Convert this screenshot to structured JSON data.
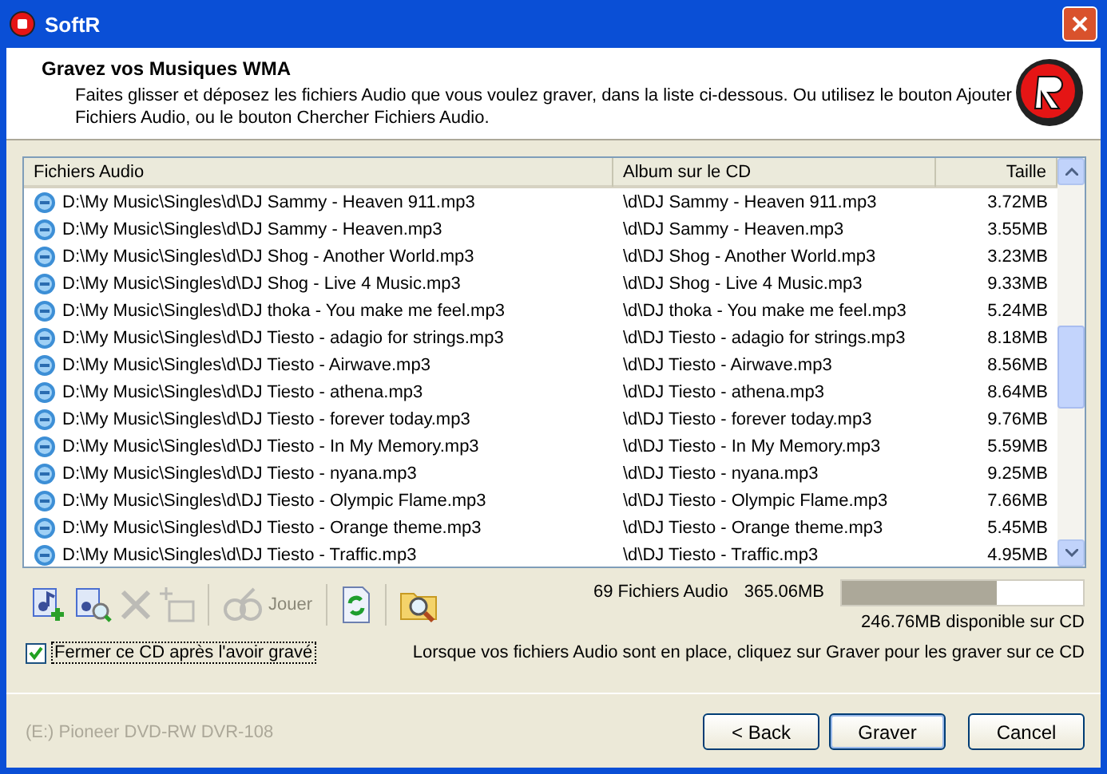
{
  "window": {
    "title": "SoftR"
  },
  "header": {
    "title": "Gravez vos Musiques WMA",
    "description": "Faites glisser et déposez les fichiers Audio que vous voulez graver, dans la liste ci-dessous. Ou utilisez le bouton Ajouter Fichiers Audio, ou le bouton Chercher Fichiers Audio."
  },
  "table": {
    "columns": [
      "Fichiers Audio",
      "Album sur le CD",
      "Taille"
    ],
    "rows": [
      {
        "file": "D:\\My Music\\Singles\\d\\DJ Sammy - Heaven 911.mp3",
        "album": "\\d\\DJ Sammy - Heaven 911.mp3",
        "size": "3.72MB"
      },
      {
        "file": "D:\\My Music\\Singles\\d\\DJ Sammy - Heaven.mp3",
        "album": "\\d\\DJ Sammy - Heaven.mp3",
        "size": "3.55MB"
      },
      {
        "file": "D:\\My Music\\Singles\\d\\DJ Shog - Another World.mp3",
        "album": "\\d\\DJ Shog - Another World.mp3",
        "size": "3.23MB"
      },
      {
        "file": "D:\\My Music\\Singles\\d\\DJ Shog - Live 4 Music.mp3",
        "album": "\\d\\DJ Shog - Live 4 Music.mp3",
        "size": "9.33MB"
      },
      {
        "file": "D:\\My Music\\Singles\\d\\DJ thoka - You make me feel.mp3",
        "album": "\\d\\DJ thoka - You make me feel.mp3",
        "size": "5.24MB"
      },
      {
        "file": "D:\\My Music\\Singles\\d\\DJ Tiesto - adagio for strings.mp3",
        "album": "\\d\\DJ Tiesto - adagio for strings.mp3",
        "size": "8.18MB"
      },
      {
        "file": "D:\\My Music\\Singles\\d\\DJ Tiesto - Airwave.mp3",
        "album": "\\d\\DJ Tiesto - Airwave.mp3",
        "size": "8.56MB"
      },
      {
        "file": "D:\\My Music\\Singles\\d\\DJ Tiesto - athena.mp3",
        "album": "\\d\\DJ Tiesto - athena.mp3",
        "size": "8.64MB"
      },
      {
        "file": "D:\\My Music\\Singles\\d\\DJ Tiesto - forever today.mp3",
        "album": "\\d\\DJ Tiesto - forever today.mp3",
        "size": "9.76MB"
      },
      {
        "file": "D:\\My Music\\Singles\\d\\DJ Tiesto - In My Memory.mp3",
        "album": "\\d\\DJ Tiesto - In My Memory.mp3",
        "size": "5.59MB"
      },
      {
        "file": "D:\\My Music\\Singles\\d\\DJ Tiesto - nyana.mp3",
        "album": "\\d\\DJ Tiesto - nyana.mp3",
        "size": "9.25MB"
      },
      {
        "file": "D:\\My Music\\Singles\\d\\DJ Tiesto - Olympic Flame.mp3",
        "album": "\\d\\DJ Tiesto - Olympic Flame.mp3",
        "size": "7.66MB"
      },
      {
        "file": "D:\\My Music\\Singles\\d\\DJ Tiesto - Orange theme.mp3",
        "album": "\\d\\DJ Tiesto - Orange theme.mp3",
        "size": "5.45MB"
      },
      {
        "file": "D:\\My Music\\Singles\\d\\DJ Tiesto - Traffic.mp3",
        "album": "\\d\\DJ Tiesto - Traffic.mp3",
        "size": "4.95MB"
      }
    ]
  },
  "toolbar": [
    {
      "kind": "add",
      "disabled": false
    },
    {
      "kind": "find",
      "disabled": false
    },
    {
      "kind": "delete",
      "disabled": true
    },
    {
      "kind": "folder",
      "disabled": true
    },
    {
      "kind": "separator"
    },
    {
      "kind": "play",
      "label": "Jouer",
      "disabled": true
    },
    {
      "kind": "separator"
    },
    {
      "kind": "refresh",
      "disabled": false
    },
    {
      "kind": "separator"
    },
    {
      "kind": "browse",
      "disabled": false
    }
  ],
  "summary": {
    "count": "69 Fichiers Audio",
    "total": "365.06MB",
    "level": 0.64,
    "free": "246.76MB disponible sur CD"
  },
  "close_cd": {
    "label": "Fermer ce CD après l'avoir gravé",
    "checked": true
  },
  "hint": "Lorsque vos fichiers Audio sont en place, cliquez sur Graver pour les graver sur ce CD",
  "drive": "(E:) Pioneer DVD-RW DVR-108",
  "buttons": [
    {
      "label": "< Back",
      "default": false
    },
    {
      "label": "Graver",
      "default": true
    },
    {
      "label": "Cancel",
      "default": false
    }
  ]
}
